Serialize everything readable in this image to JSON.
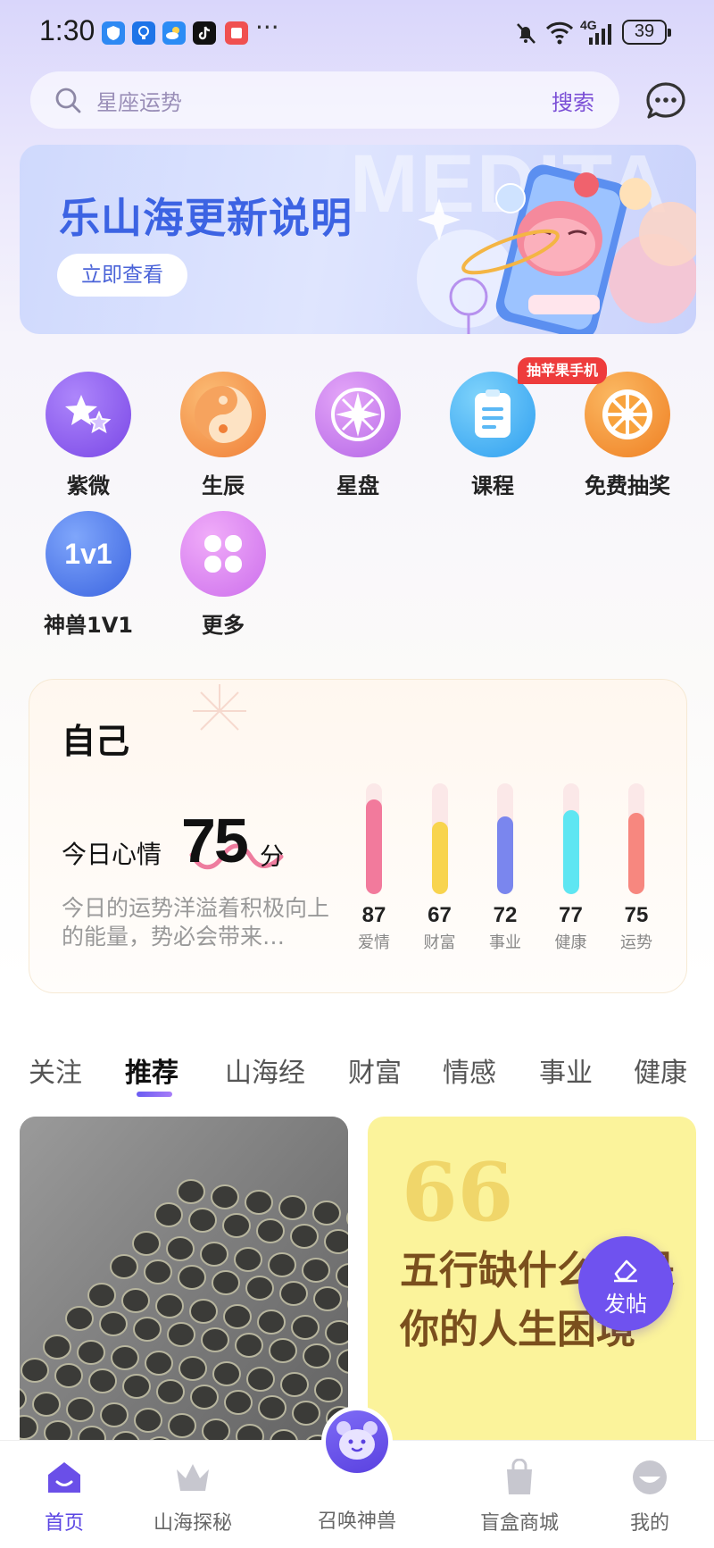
{
  "status_bar": {
    "time": "1:30",
    "more_indicator": "···",
    "battery": "39",
    "network": "4G"
  },
  "search": {
    "placeholder": "星座运势",
    "button_label": "搜索"
  },
  "banner": {
    "bg_text": "MEDITA",
    "title": "乐山海更新说明",
    "button_label": "立即查看"
  },
  "services": [
    {
      "label": "紫微",
      "icon": "star-icon",
      "color": "#8b5cf0"
    },
    {
      "label": "生辰",
      "icon": "yin-yang-icon",
      "color": "#f59a4c"
    },
    {
      "label": "星盘",
      "icon": "compass-star-icon",
      "color": "#c275ea"
    },
    {
      "label": "课程",
      "icon": "notebook-icon",
      "color": "#3fb2f4"
    },
    {
      "label": "免费抽奖",
      "icon": "wheel-icon",
      "color": "#f5962f"
    },
    {
      "label": "神兽1V1",
      "icon": "1v1-icon",
      "icon_text": "1v1",
      "color": "#4b74e8"
    },
    {
      "label": "更多",
      "icon": "clover-icon",
      "color": "#dd84ef"
    }
  ],
  "promo_badge": "抽苹果手机",
  "fortune": {
    "title": "自己",
    "mood_label": "今日心情",
    "score": "75",
    "score_unit": "分",
    "description": "今日的运势洋溢着积极向上的能量，势必会带来…",
    "metrics": [
      {
        "label": "爱情",
        "value": 87,
        "color": "#f27a9c"
      },
      {
        "label": "财富",
        "value": 67,
        "color": "#f8d44e"
      },
      {
        "label": "事业",
        "value": 72,
        "color": "#7a86ee"
      },
      {
        "label": "健康",
        "value": 77,
        "color": "#5ee6f2"
      },
      {
        "label": "运势",
        "value": 75,
        "color": "#f7877f"
      }
    ]
  },
  "tabs": [
    "关注",
    "推荐",
    "山海经",
    "财富",
    "情感",
    "事业",
    "健康"
  ],
  "active_tab": "推荐",
  "feed": {
    "quote_mark": "66",
    "quote_text": "五行缺什么就是你的人生困境"
  },
  "post_button": "发帖",
  "bottom_nav": [
    {
      "label": "首页",
      "icon": "home-icon"
    },
    {
      "label": "山海探秘",
      "icon": "crown-icon"
    },
    {
      "label": "召唤神兽",
      "icon": "bear-icon"
    },
    {
      "label": "盲盒商城",
      "icon": "bag-icon"
    },
    {
      "label": "我的",
      "icon": "profile-icon"
    }
  ],
  "colors": {
    "accent": "#6f52ef",
    "banner_title": "#3c63e3",
    "badge": "#ee3c3c"
  }
}
